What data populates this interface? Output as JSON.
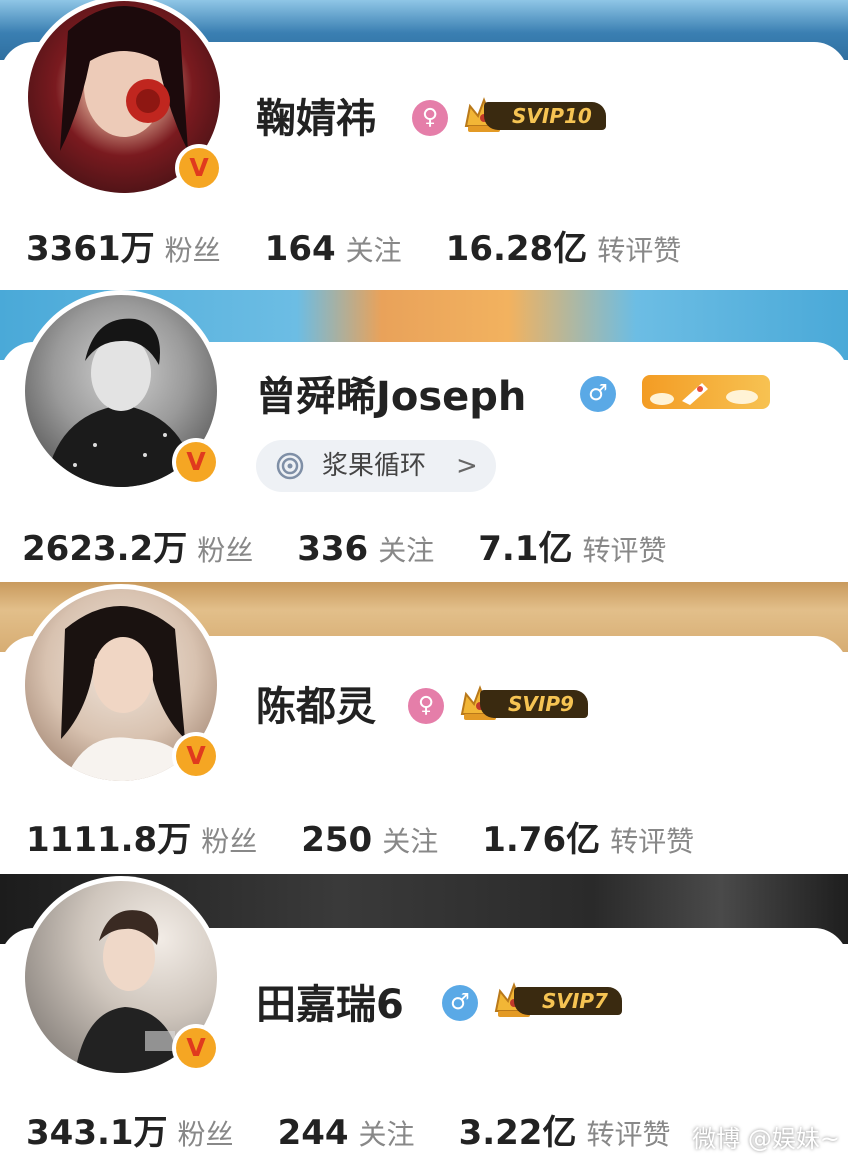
{
  "profiles": [
    {
      "name": "鞠婧祎",
      "gender_icon": "female-icon",
      "gender_glyph": "♀",
      "membership": "SVIP10",
      "verified": "V",
      "stats": [
        {
          "value": "3361万",
          "label": "粉丝"
        },
        {
          "value": "164",
          "label": "关注"
        },
        {
          "value": "16.28亿",
          "label": "转评赞"
        }
      ]
    },
    {
      "name": "曾舜晞Joseph",
      "gender_icon": "male-icon",
      "gender_glyph": "♂",
      "membership_icon": "rocket-icon",
      "group_label": "浆果循环",
      "group_chevron": ">",
      "verified": "V",
      "stats": [
        {
          "value": "2623.2万",
          "label": "粉丝"
        },
        {
          "value": "336",
          "label": "关注"
        },
        {
          "value": "7.1亿",
          "label": "转评赞"
        }
      ]
    },
    {
      "name": "陈都灵",
      "gender_icon": "female-icon",
      "gender_glyph": "♀",
      "membership": "SVIP9",
      "verified": "V",
      "stats": [
        {
          "value": "1111.8万",
          "label": "粉丝"
        },
        {
          "value": "250",
          "label": "关注"
        },
        {
          "value": "1.76亿",
          "label": "转评赞"
        }
      ]
    },
    {
      "name": "田嘉瑞6",
      "gender_icon": "male-icon",
      "gender_glyph": "♂",
      "membership": "SVIP7",
      "verified": "V",
      "stats": [
        {
          "value": "343.1万",
          "label": "粉丝"
        },
        {
          "value": "244",
          "label": "关注"
        },
        {
          "value": "3.22亿",
          "label": "转评赞"
        }
      ]
    }
  ],
  "watermark": "微博 @娱妹~",
  "colors": {
    "female": "#e57ea9",
    "male": "#5aa9e6",
    "verified_badge": "#f5a623",
    "stat_number": "#222222",
    "stat_label": "#888888"
  }
}
